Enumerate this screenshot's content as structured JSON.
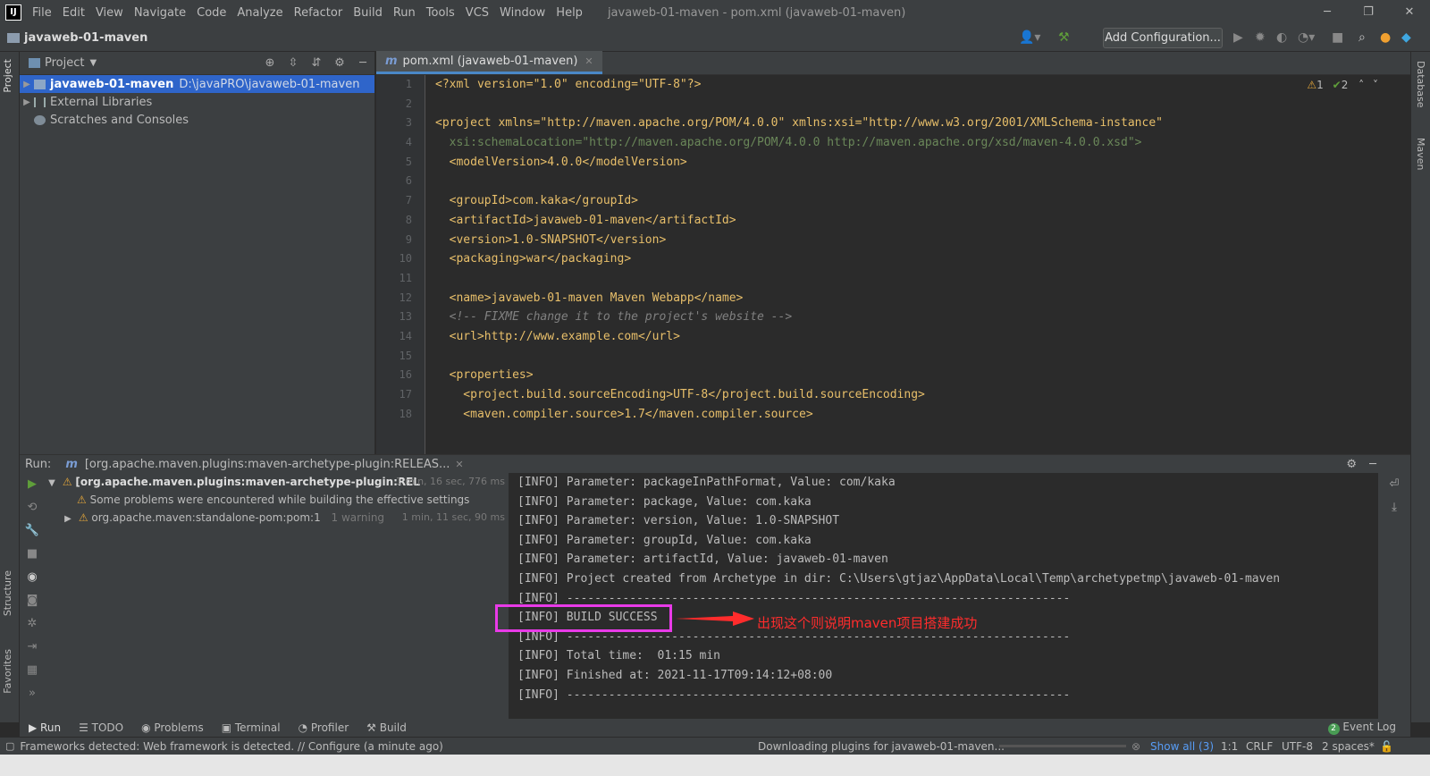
{
  "menubar": {
    "items": [
      "File",
      "Edit",
      "View",
      "Navigate",
      "Code",
      "Analyze",
      "Refactor",
      "Build",
      "Run",
      "Tools",
      "VCS",
      "Window",
      "Help"
    ],
    "window_title": "javaweb-01-maven - pom.xml (javaweb-01-maven)"
  },
  "navbar": {
    "project_name": "javaweb-01-maven",
    "add_configuration": "Add Configuration..."
  },
  "left_strip": {
    "project": "Project",
    "structure": "Structure",
    "favorites": "Favorites"
  },
  "right_strip": {
    "database": "Database",
    "maven": "Maven"
  },
  "project_panel": {
    "title": "Project",
    "tree": [
      {
        "label": "javaweb-01-maven",
        "path": "D:\\javaPRO\\javaweb-01-maven"
      },
      {
        "label": "External Libraries"
      },
      {
        "label": "Scratches and Consoles"
      }
    ]
  },
  "editor": {
    "tab_label": "pom.xml (javaweb-01-maven)",
    "inspections": {
      "warnings": "1",
      "ok": "2"
    },
    "line_numbers": [
      "1",
      "2",
      "3",
      "4",
      "5",
      "6",
      "7",
      "8",
      "9",
      "10",
      "11",
      "12",
      "13",
      "14",
      "15",
      "16",
      "17",
      "18"
    ],
    "lines": [
      "<?xml version=\"1.0\" encoding=\"UTF-8\"?>",
      "",
      "<project xmlns=\"http://maven.apache.org/POM/4.0.0\" xmlns:xsi=\"http://www.w3.org/2001/XMLSchema-instance\"",
      "  xsi:schemaLocation=\"http://maven.apache.org/POM/4.0.0 http://maven.apache.org/xsd/maven-4.0.0.xsd\">",
      "  <modelVersion>4.0.0</modelVersion>",
      "",
      "  <groupId>com.kaka</groupId>",
      "  <artifactId>javaweb-01-maven</artifactId>",
      "  <version>1.0-SNAPSHOT</version>",
      "  <packaging>war</packaging>",
      "",
      "  <name>javaweb-01-maven Maven Webapp</name>",
      "  <!-- FIXME change it to the project's website -->",
      "  <url>http://www.example.com</url>",
      "",
      "  <properties>",
      "    <project.build.sourceEncoding>UTF-8</project.build.sourceEncoding>",
      "    <maven.compiler.source>1.7</maven.compiler.source>"
    ]
  },
  "run_panel": {
    "label": "Run:",
    "tab": "[org.apache.maven.plugins:maven-archetype-plugin:RELEAS...",
    "tree": [
      {
        "label": "[org.apache.maven.plugins:maven-archetype-plugin:REL",
        "time": "1 min, 16 sec, 776 ms"
      },
      {
        "label": "Some problems were encountered while building the effective settings"
      },
      {
        "label": "org.apache.maven:standalone-pom:pom:1",
        "extra": "1 warning",
        "time": "1 min, 11 sec, 90 ms"
      }
    ],
    "console": [
      "[INFO] Parameter: packageInPathFormat, Value: com/kaka",
      "[INFO] Parameter: package, Value: com.kaka",
      "[INFO] Parameter: version, Value: 1.0-SNAPSHOT",
      "[INFO] Parameter: groupId, Value: com.kaka",
      "[INFO] Parameter: artifactId, Value: javaweb-01-maven",
      "[INFO] Project created from Archetype in dir: C:\\Users\\gtjaz\\AppData\\Local\\Temp\\archetypetmp\\javaweb-01-maven",
      "[INFO] ------------------------------------------------------------------------",
      "[INFO] BUILD SUCCESS",
      "[INFO] ------------------------------------------------------------------------",
      "[INFO] Total time:  01:15 min",
      "[INFO] Finished at: 2021-11-17T09:14:12+08:00",
      "[INFO] ------------------------------------------------------------------------"
    ],
    "annotation": "出现这个则说明maven项目搭建成功"
  },
  "bottom_tabs": {
    "run": "Run",
    "todo": "TODO",
    "problems": "Problems",
    "terminal": "Terminal",
    "profiler": "Profiler",
    "build": "Build",
    "event_log": "Event Log",
    "event_count": "2"
  },
  "status_bar": {
    "message": "Frameworks detected: Web framework is detected. // Configure (a minute ago)",
    "progress": "Downloading plugins for javaweb-01-maven...",
    "show_all": "Show all (3)",
    "position": "1:1",
    "line_sep": "CRLF",
    "encoding": "UTF-8",
    "indent": "2 spaces*"
  },
  "colors": {
    "selection": "#2f65ca",
    "highlight_box": "#e93ae8",
    "annotation": "#ff2c2c"
  }
}
